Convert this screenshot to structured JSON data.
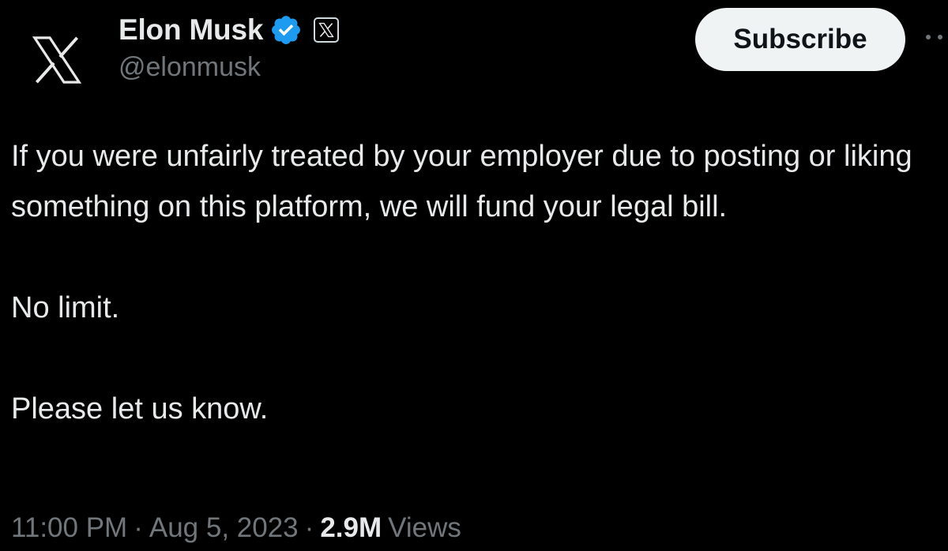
{
  "tweet": {
    "author": {
      "display_name": "Elon Musk",
      "handle": "@elonmusk",
      "avatar_icon": "x-logo-icon",
      "verified_icon": "verified-badge-icon",
      "affiliate_icon": "x-affiliate-badge-icon"
    },
    "subscribe_label": "Subscribe",
    "more_icon": "more-options-icon",
    "paragraphs": [
      "If you were unfairly treated by your employer due to posting or liking something on this platform, we will fund your legal bill.",
      "No limit.",
      "Please let us know."
    ],
    "time": "11:00 PM",
    "date": "Aug 5, 2023",
    "separator": "·",
    "views_count": "2.9M",
    "views_label": "Views"
  },
  "colors": {
    "background": "#000000",
    "text_primary": "#e7e9ea",
    "text_secondary": "#71767b",
    "verified_blue": "#1d9bf0",
    "subscribe_bg": "#eff3f4",
    "subscribe_text": "#0f1419"
  }
}
